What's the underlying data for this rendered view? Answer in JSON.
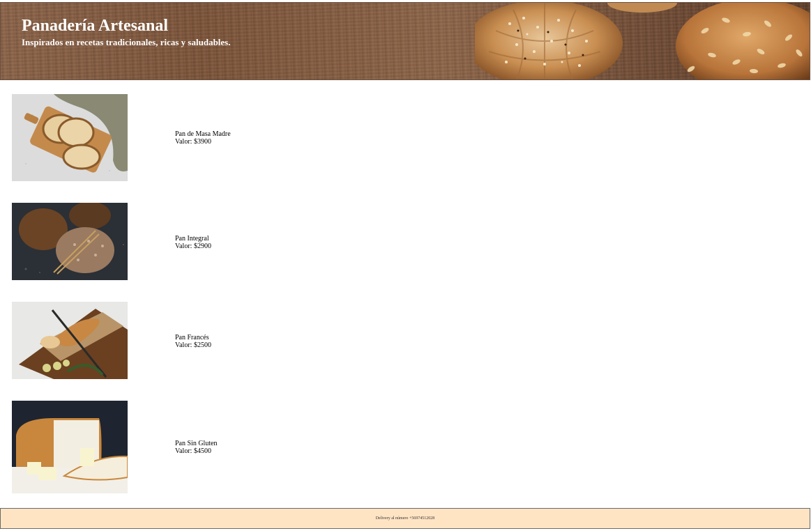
{
  "header": {
    "title": "Panadería Artesanal",
    "subtitle": "Inspirados en recetas tradicionales, ricas y saludables."
  },
  "products": [
    {
      "name": "Pan de Masa Madre",
      "price": "Valor: $3900"
    },
    {
      "name": "Pan Integral",
      "price": "Valor: $2900"
    },
    {
      "name": "Pan Francés",
      "price": "Valor: $2500"
    },
    {
      "name": "Pan Sin Gluten",
      "price": "Valor: $4500"
    }
  ],
  "footer": {
    "text": "Delivery al número +56974512028"
  },
  "colors": {
    "footer_bg": "#ffe4c4",
    "title_text": "#ffffff"
  }
}
